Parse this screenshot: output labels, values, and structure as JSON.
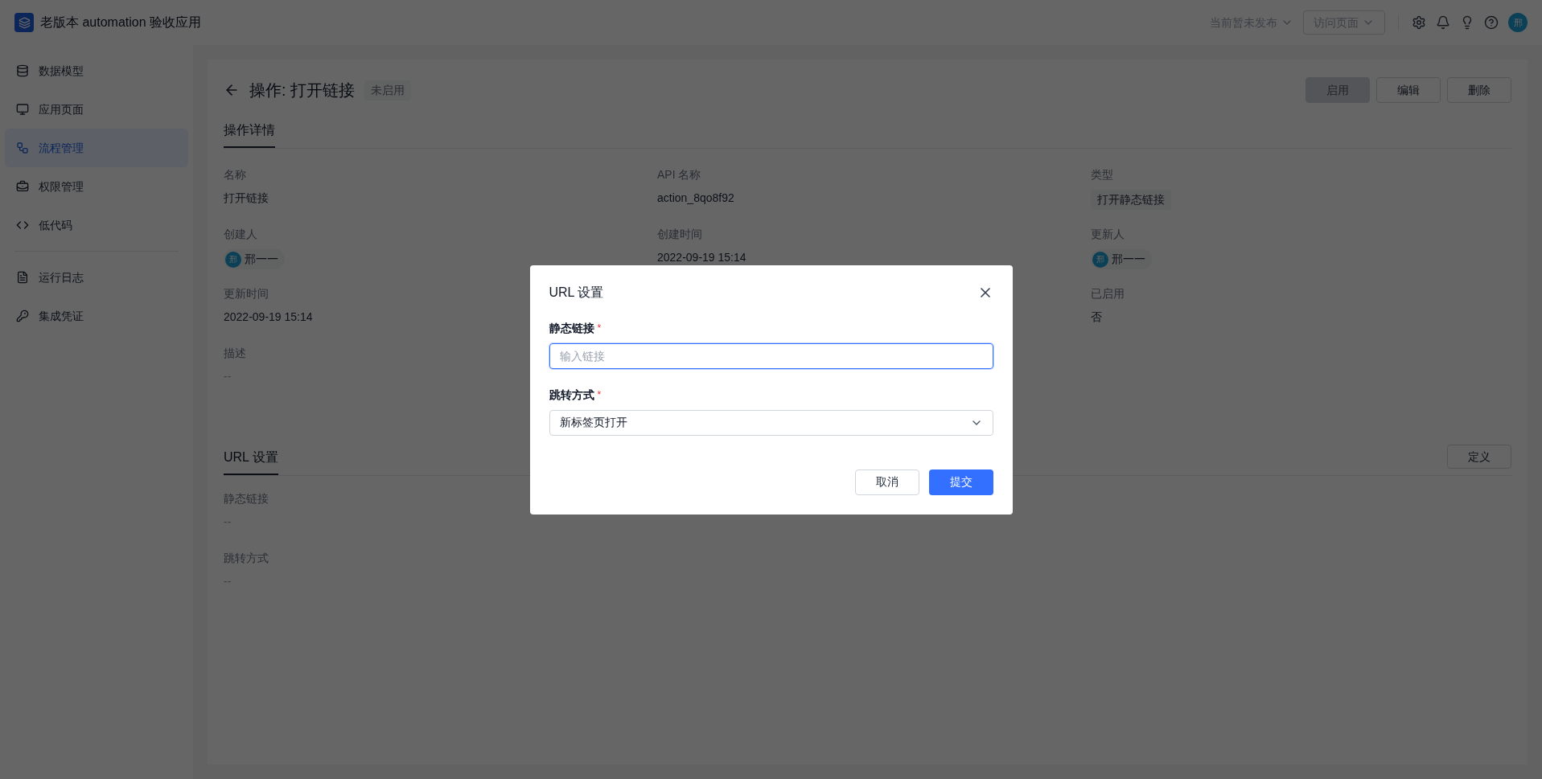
{
  "app": {
    "title": "老版本 automation 验收应用"
  },
  "topbar": {
    "publish_status": "当前暂未发布",
    "visit_button": "访问页面",
    "avatar": "邢"
  },
  "sidebar": {
    "groups": [
      [
        {
          "label": "数据模型",
          "selected": false
        },
        {
          "label": "应用页面",
          "selected": false
        },
        {
          "label": "流程管理",
          "selected": true
        },
        {
          "label": "权限管理",
          "selected": false
        },
        {
          "label": "低代码",
          "selected": false
        }
      ],
      [
        {
          "label": "运行日志",
          "selected": false
        },
        {
          "label": "集成凭证",
          "selected": false
        }
      ]
    ]
  },
  "page": {
    "title": "操作: 打开链接",
    "status_badge": "未启用",
    "actions": [
      {
        "label": "启用",
        "disabled": true
      },
      {
        "label": "编辑",
        "disabled": false
      },
      {
        "label": "删除",
        "disabled": false
      }
    ],
    "details": {
      "title": "操作详情",
      "columns": [
        [
          {
            "label": "名称",
            "value": "打开链接",
            "kind": "text"
          },
          {
            "label": "创建人",
            "value": "邢一一",
            "avatar": "邢",
            "kind": "user"
          },
          {
            "label": "更新时间",
            "value": "2022-09-19 15:14",
            "kind": "text"
          },
          {
            "label": "描述",
            "value": "--",
            "kind": "empty"
          }
        ],
        [
          {
            "label": "API 名称",
            "value": "action_8qo8f92",
            "kind": "text"
          },
          {
            "label": "创建时间",
            "value": "2022-09-19 15:14",
            "kind": "text"
          }
        ],
        [
          {
            "label": "类型",
            "value": "打开静态链接",
            "kind": "tag"
          },
          {
            "label": "更新人",
            "value": "邢一一",
            "avatar": "邢",
            "kind": "user"
          },
          {
            "label": "已启用",
            "value": "否",
            "kind": "text"
          }
        ]
      ]
    },
    "url_section": {
      "title": "URL 设置",
      "action": "定义",
      "fields": [
        {
          "label": "静态链接",
          "value": "--",
          "kind": "empty"
        },
        {
          "label": "跳转方式",
          "value": "--",
          "kind": "empty"
        }
      ]
    }
  },
  "modal": {
    "title": "URL 设置",
    "fields": [
      {
        "label": "静态链接",
        "required_mark": "*",
        "kind": "input",
        "placeholder": "输入链接",
        "focused": true
      },
      {
        "label": "跳转方式",
        "required_mark": "*",
        "kind": "select",
        "value": "新标签页打开"
      }
    ],
    "buttons": [
      {
        "label": "取消",
        "kind": "secondary"
      },
      {
        "label": "提交",
        "kind": "primary"
      }
    ]
  }
}
